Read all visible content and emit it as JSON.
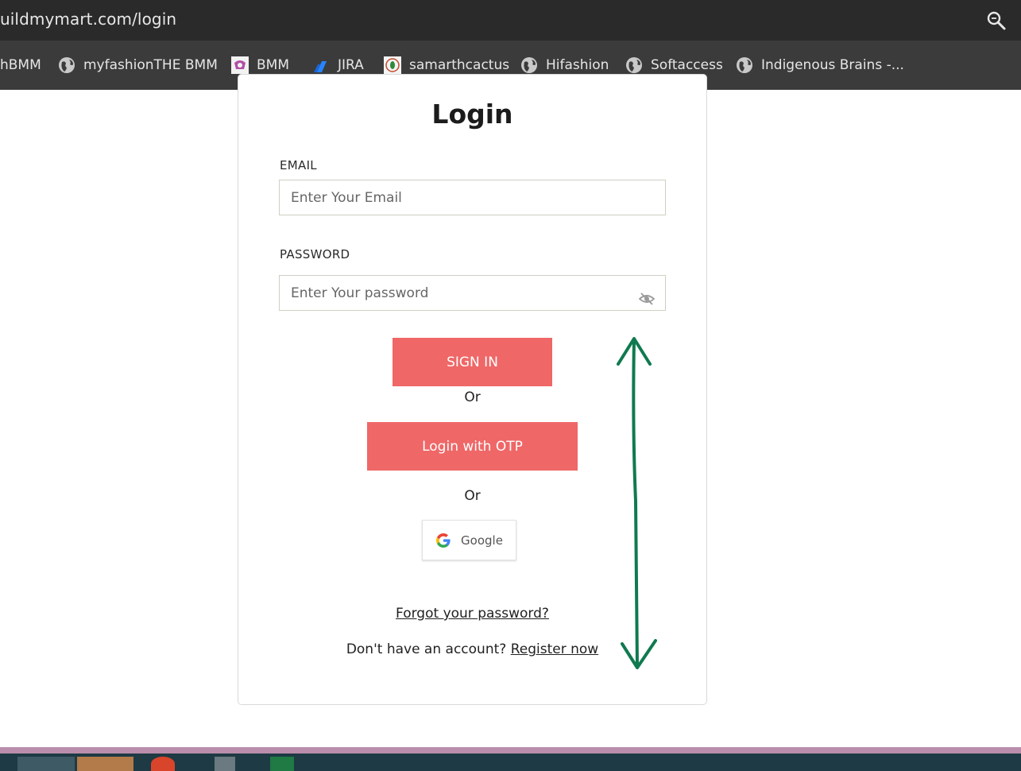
{
  "browser": {
    "url": "uildmymart.com/login",
    "zoom_icon": "magnifier-zoom-icon"
  },
  "bookmarks": [
    {
      "label": "hBMM",
      "icon": "none"
    },
    {
      "label": "myfashionTHE BMM",
      "icon": "globe-icon"
    },
    {
      "label": "BMM",
      "icon": "bmm-logo-icon"
    },
    {
      "label": "JIRA",
      "icon": "jira-icon"
    },
    {
      "label": "samarthcactus",
      "icon": "samarth-logo-icon"
    },
    {
      "label": "Hifashion",
      "icon": "globe-icon"
    },
    {
      "label": "Softaccess",
      "icon": "globe-icon"
    },
    {
      "label": "Indigenous Brains -...",
      "icon": "globe-icon"
    }
  ],
  "login": {
    "title": "Login",
    "email_label": "EMAIL",
    "email_placeholder": "Enter Your Email",
    "password_label": "PASSWORD",
    "password_placeholder": "Enter Your password",
    "sign_in": "SIGN IN",
    "or1": "Or",
    "otp": "Login with OTP",
    "or2": "Or",
    "google": "Google",
    "forgot": "Forgot your password?",
    "no_account": "Don't have an account?",
    "register": "Register now"
  },
  "colors": {
    "accent": "#ef6767",
    "annotation_arrow": "#0f7a4f",
    "addressbar": "#2a2a2a",
    "bookmarkbar": "#3b3b3b"
  }
}
